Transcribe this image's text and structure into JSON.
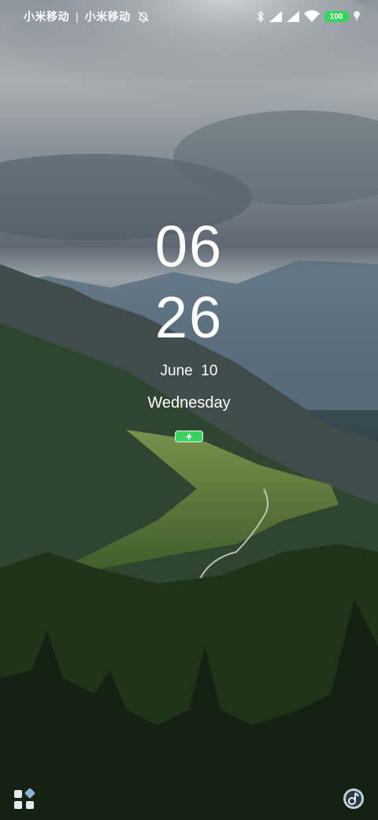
{
  "status_bar": {
    "carrier_1": "小米移动",
    "separator": "|",
    "carrier_2": "小米移动",
    "battery_level": "100",
    "icons": [
      "bell-off-icon",
      "bluetooth-icon",
      "signal-icon",
      "signal-icon",
      "wifi-icon",
      "battery-icon",
      "location-icon"
    ]
  },
  "lock_screen": {
    "hour": "06",
    "minute": "26",
    "date": "June  10",
    "weekday": "Wednesday",
    "charging_icon": "charging-bolt-icon"
  },
  "bottom_controls": {
    "left_icon": "app-grid-icon",
    "right_icon": "music-note-icon"
  },
  "colors": {
    "battery_green": "#3ad35e",
    "text": "#ffffff"
  }
}
